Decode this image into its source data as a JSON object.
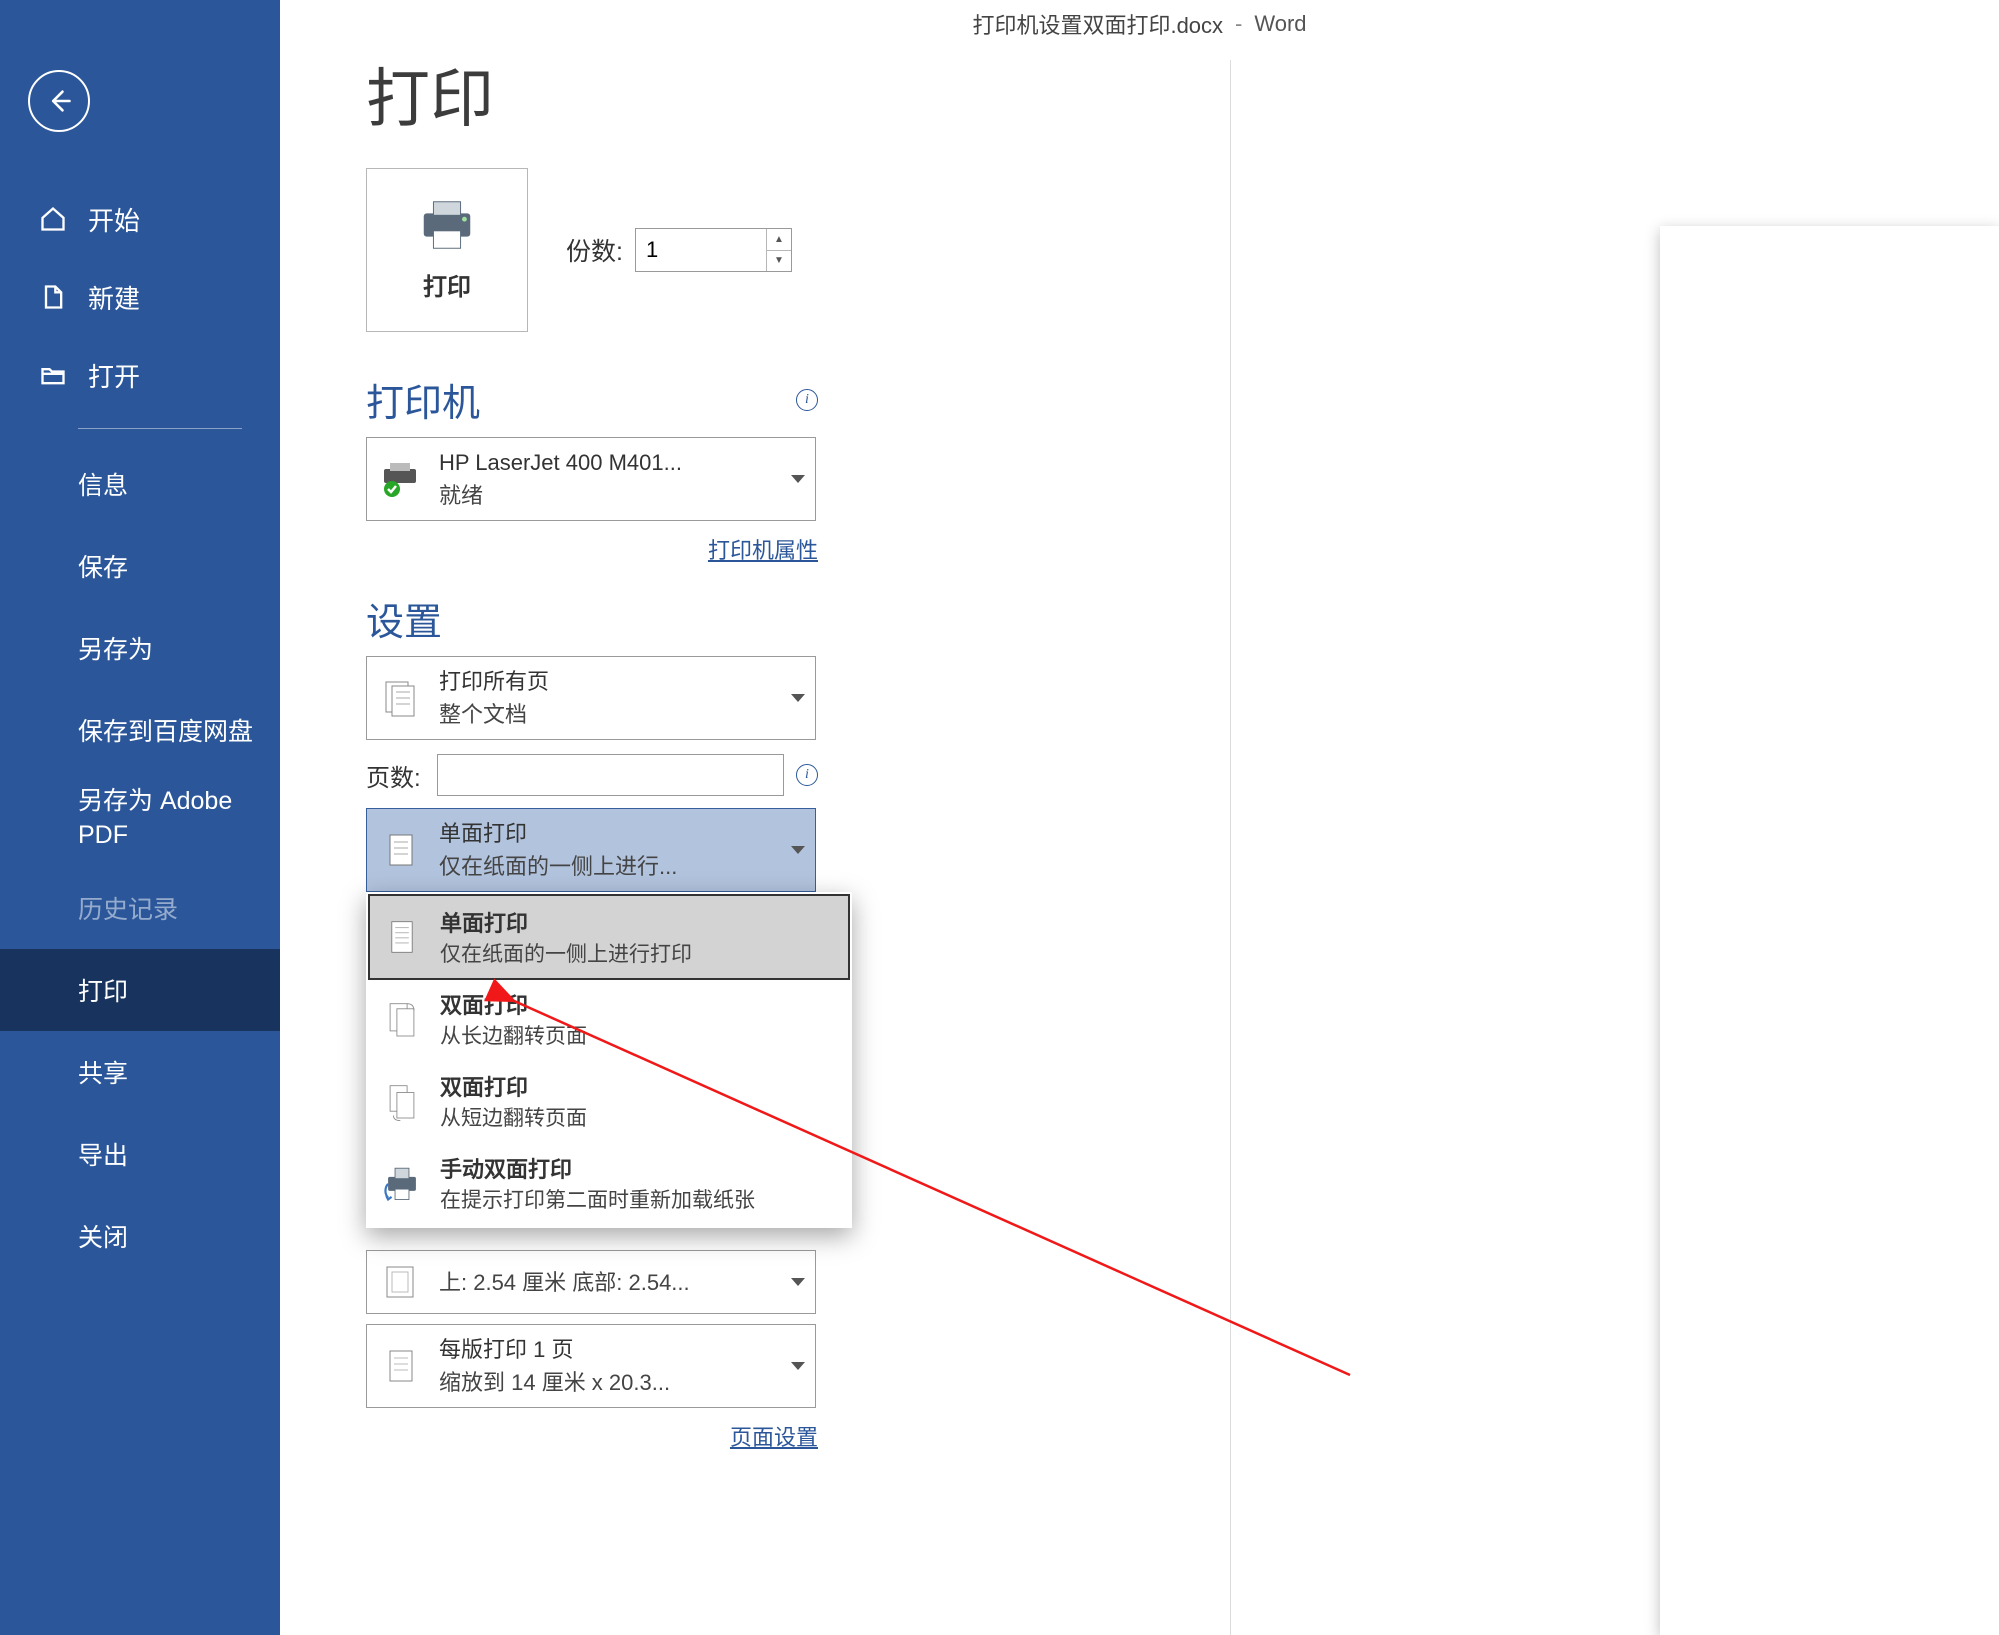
{
  "title_bar": {
    "document": "打印机设置双面打印.docx",
    "app": "Word",
    "separator": "-"
  },
  "sidebar": {
    "top": [
      {
        "id": "home",
        "label": "开始"
      },
      {
        "id": "new",
        "label": "新建"
      },
      {
        "id": "open",
        "label": "打开"
      }
    ],
    "items": [
      {
        "id": "info",
        "label": "信息"
      },
      {
        "id": "save",
        "label": "保存"
      },
      {
        "id": "saveas",
        "label": "另存为"
      },
      {
        "id": "save_baidu",
        "label": "保存到百度网盘"
      },
      {
        "id": "save_pdf",
        "label_line1": "另存为 Adobe",
        "label_line2": "PDF"
      },
      {
        "id": "history",
        "label": "历史记录",
        "disabled": true
      },
      {
        "id": "print",
        "label": "打印",
        "active": true
      },
      {
        "id": "share",
        "label": "共享"
      },
      {
        "id": "export",
        "label": "导出"
      },
      {
        "id": "close",
        "label": "关闭"
      }
    ]
  },
  "main": {
    "heading": "打印",
    "print_button": "打印",
    "copies_label": "份数:",
    "copies_value": "1",
    "printer_heading": "打印机",
    "printer": {
      "name": "HP LaserJet 400 M401...",
      "status": "就绪"
    },
    "printer_properties_link": "打印机属性",
    "settings_heading": "设置",
    "print_range": {
      "line1": "打印所有页",
      "line2": "整个文档"
    },
    "pages_label": "页数:",
    "pages_value": "",
    "duplex_selected": {
      "line1": "单面打印",
      "line2": "仅在纸面的一侧上进行..."
    },
    "duplex_options": [
      {
        "id": "single",
        "line1": "单面打印",
        "line2": "仅在纸面的一侧上进行打印",
        "selected": true
      },
      {
        "id": "duplex_long",
        "line1": "双面打印",
        "line2": "从长边翻转页面"
      },
      {
        "id": "duplex_short",
        "line1": "双面打印",
        "line2": "从短边翻转页面"
      },
      {
        "id": "manual_duplex",
        "line1": "手动双面打印",
        "line2": "在提示打印第二面时重新加载纸张"
      }
    ],
    "margins": {
      "line2": "上: 2.54 厘米 底部: 2.54..."
    },
    "pages_per_sheet": {
      "line1": "每版打印 1 页",
      "line2": "缩放到 14 厘米 x 20.3..."
    },
    "page_setup_link": "页面设置"
  }
}
